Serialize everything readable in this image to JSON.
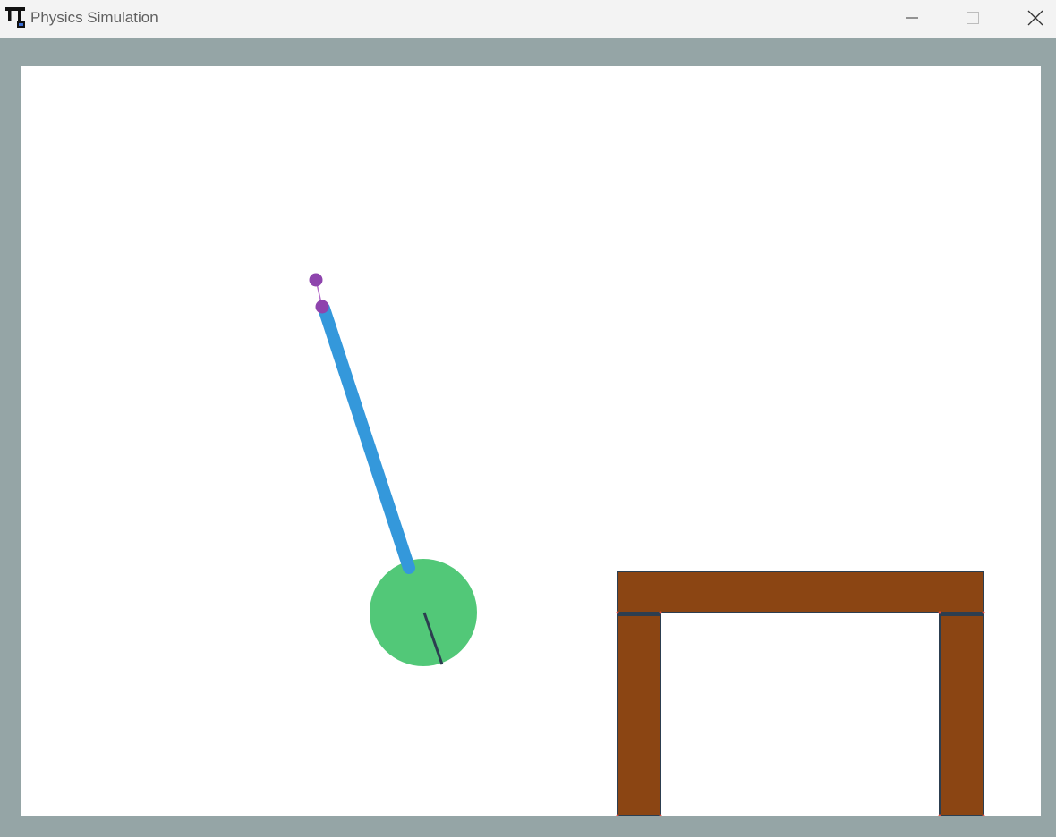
{
  "window": {
    "title": "Physics Simulation",
    "controls": {
      "minimize": "minimize-icon",
      "maximize": "maximize-icon",
      "close": "close-icon"
    }
  },
  "colors": {
    "frame": "#95a5a6",
    "titlebar": "#f3f3f3",
    "canvas": "#ffffff",
    "pendulum_rod": "#3498db",
    "pivot": "#8e44ad",
    "ball": "#52c878",
    "ball_marker": "#2c3e50",
    "table_wood": "#8b4513",
    "table_outline": "#2c3e50",
    "contact_point": "#e74c3c"
  },
  "scene": {
    "objects": [
      {
        "kind": "pivot-anchor",
        "icon": "pivot-anchor-dot"
      },
      {
        "kind": "pendulum-joint",
        "icon": "pendulum-joint-dot"
      },
      {
        "kind": "pendulum-rod"
      },
      {
        "kind": "ball",
        "icon": "ball-circle"
      },
      {
        "kind": "table"
      }
    ]
  }
}
